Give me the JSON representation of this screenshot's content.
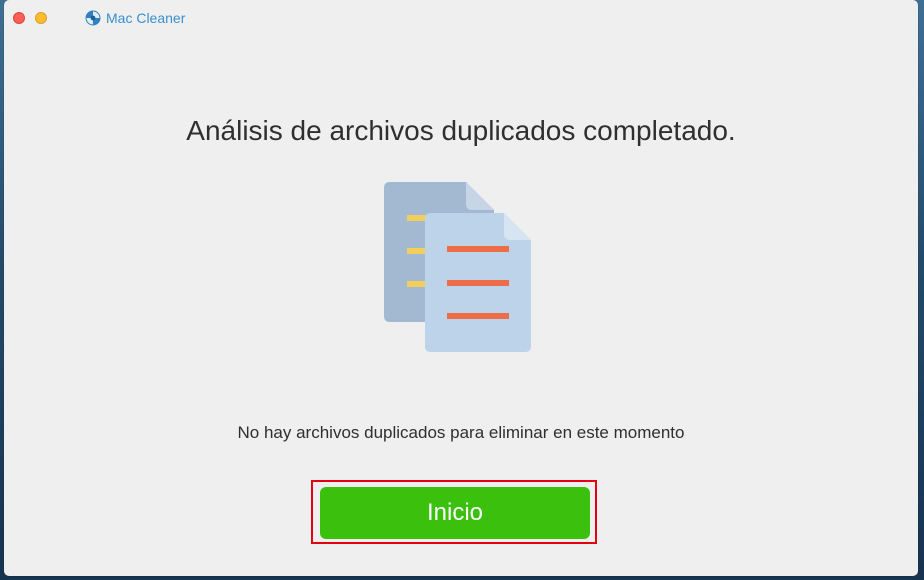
{
  "window": {
    "title": "Mac Cleaner",
    "controls": [
      "close",
      "minimize"
    ]
  },
  "main": {
    "headline": "Análisis de archivos duplicados completado.",
    "illustration_icon": "duplicate-documents-icon",
    "message": "No hay archivos duplicados para eliminar en este momento",
    "primary_button_label": "Inicio"
  },
  "colors": {
    "accent_green": "#3ac00d",
    "title_blue": "#3a8fd0",
    "highlight_red": "#e3000f"
  }
}
